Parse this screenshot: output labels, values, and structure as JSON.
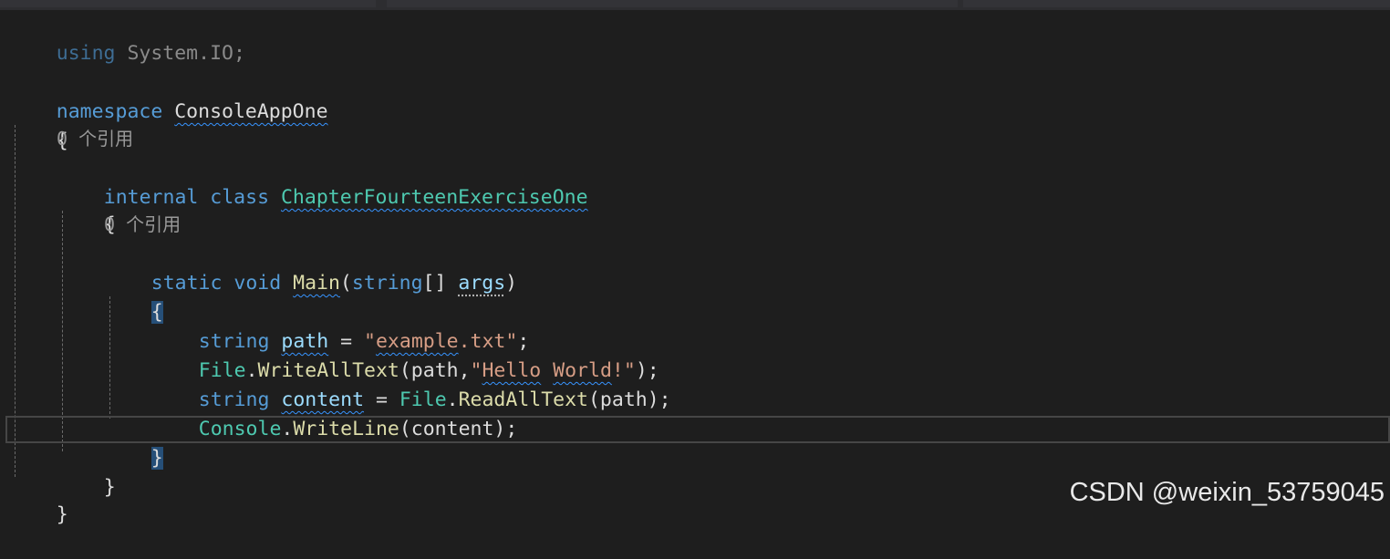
{
  "editor": {
    "lines": {
      "l1": {
        "kw": "using",
        "rest": " System.IO;"
      },
      "l2": {
        "kw": "namespace",
        "name": "ConsoleAppOne"
      },
      "l3": {
        "brace": "{"
      },
      "lens1": "0 个引用",
      "l4": {
        "kw1": "internal",
        "kw2": "class",
        "name": "ChapterFourteenExerciseOne"
      },
      "l5": {
        "brace": "{"
      },
      "lens2": "0 个引用",
      "l6": {
        "kw1": "static",
        "kw2": "void",
        "method": "Main",
        "open": "(",
        "type": "string",
        "arr": "[]",
        "param": "args",
        "close": ")"
      },
      "l7": {
        "brace": "{"
      },
      "l8": {
        "kw": "string",
        "var": "path",
        "eq": " = ",
        "str_q1": "\"",
        "str_word": "example",
        "str_rest": ".txt",
        "str_q2": "\"",
        "end": ";"
      },
      "l9": {
        "type": "File",
        "dot": ".",
        "method": "WriteAllText",
        "open": "(path,",
        "str_q1": "\"",
        "str_w1": "Hello",
        "str_sp": " ",
        "str_w2": "World",
        "str_rest": "!",
        "str_q2": "\"",
        "end": ");"
      },
      "l10": {
        "kw": "string",
        "var": "content",
        "eq": " = ",
        "type": "File",
        "dot": ".",
        "method": "ReadAllText",
        "args": "(path);"
      },
      "l11": {
        "type": "Console",
        "dot": ".",
        "method": "WriteLine",
        "args": "(content);"
      },
      "l12": {
        "brace": "}"
      },
      "l13": {
        "brace": "}"
      },
      "l14": {
        "brace": "}"
      }
    },
    "colors": {
      "background": "#1e1e1e",
      "keyword": "#569cd6",
      "type": "#4ec9b0",
      "method": "#dcdcaa",
      "string": "#d69d85",
      "squiggle": "#3794ff",
      "brace_highlight": "#264f78"
    }
  },
  "watermark": "CSDN @weixin_53759045"
}
